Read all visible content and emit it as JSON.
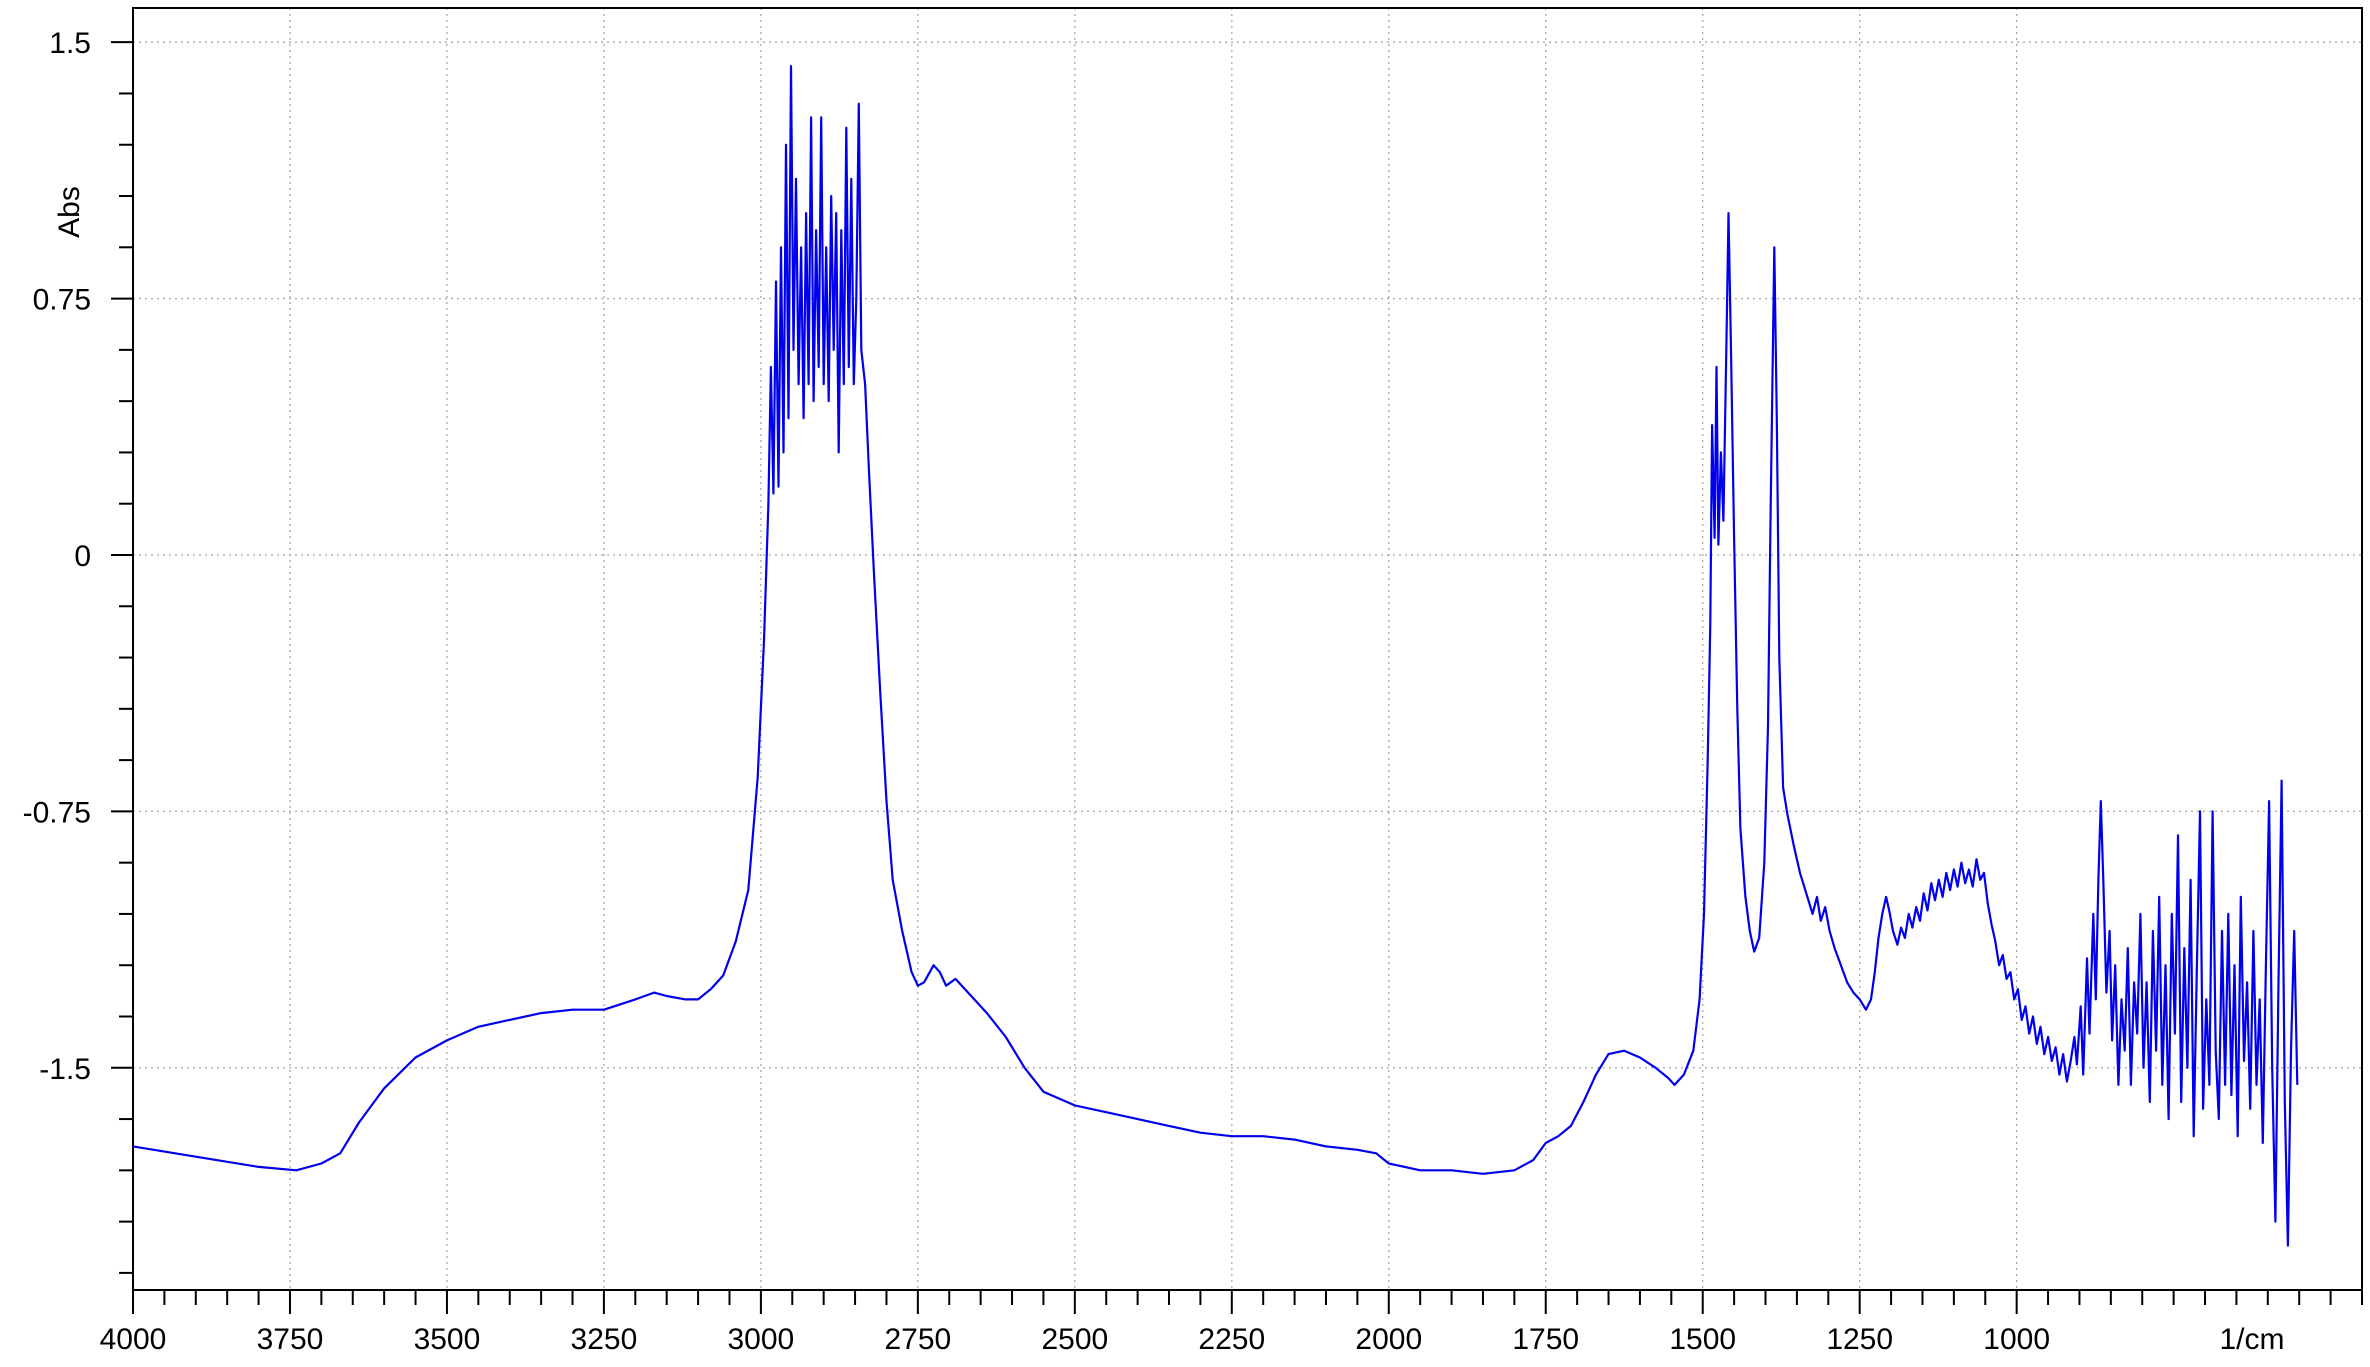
{
  "chart_data": {
    "type": "line",
    "ylabel": "Abs",
    "xlabel": "1/cm",
    "x_reversed": true,
    "xlim": [
      4000,
      450
    ],
    "ylim": [
      -2.15,
      1.6
    ],
    "x_ticks": [
      4000,
      3750,
      3500,
      3250,
      3000,
      2750,
      2500,
      2250,
      2000,
      1750,
      1500,
      1250,
      1000
    ],
    "x_tick_labels": [
      "4000",
      "3750",
      "3500",
      "3250",
      "3000",
      "2750",
      "2500",
      "2250",
      "2000",
      "1750",
      "1500",
      "1250",
      "1000"
    ],
    "x_minor_step": 50,
    "y_ticks": [
      1.5,
      0.75,
      0,
      -0.75,
      -1.5
    ],
    "y_tick_labels": [
      "1.5",
      "0.75",
      "0",
      "-0.75",
      "-1.5"
    ],
    "y_minor_step": 0.15,
    "grid": true,
    "colors": {
      "line": "#0000ee",
      "grid": "#a8a8a8",
      "frame": "#000000"
    },
    "series": [
      {
        "points": [
          [
            4000,
            -1.73
          ],
          [
            3900,
            -1.76
          ],
          [
            3800,
            -1.79
          ],
          [
            3740,
            -1.8
          ],
          [
            3700,
            -1.78
          ],
          [
            3670,
            -1.75
          ],
          [
            3640,
            -1.66
          ],
          [
            3600,
            -1.56
          ],
          [
            3550,
            -1.47
          ],
          [
            3500,
            -1.42
          ],
          [
            3450,
            -1.38
          ],
          [
            3400,
            -1.36
          ],
          [
            3350,
            -1.34
          ],
          [
            3300,
            -1.33
          ],
          [
            3250,
            -1.33
          ],
          [
            3200,
            -1.3
          ],
          [
            3170,
            -1.28
          ],
          [
            3150,
            -1.29
          ],
          [
            3120,
            -1.3
          ],
          [
            3100,
            -1.3
          ],
          [
            3080,
            -1.27
          ],
          [
            3060,
            -1.23
          ],
          [
            3040,
            -1.13
          ],
          [
            3020,
            -0.98
          ],
          [
            3005,
            -0.65
          ],
          [
            2995,
            -0.25
          ],
          [
            2988,
            0.15
          ],
          [
            2984,
            0.55
          ],
          [
            2980,
            0.18
          ],
          [
            2976,
            0.8
          ],
          [
            2972,
            0.2
          ],
          [
            2968,
            0.9
          ],
          [
            2964,
            0.3
          ],
          [
            2960,
            1.2
          ],
          [
            2956,
            0.4
          ],
          [
            2952,
            1.43
          ],
          [
            2948,
            0.6
          ],
          [
            2944,
            1.1
          ],
          [
            2940,
            0.5
          ],
          [
            2936,
            0.9
          ],
          [
            2932,
            0.4
          ],
          [
            2928,
            1.0
          ],
          [
            2924,
            0.5
          ],
          [
            2920,
            1.28
          ],
          [
            2916,
            0.45
          ],
          [
            2912,
            0.95
          ],
          [
            2908,
            0.55
          ],
          [
            2904,
            1.28
          ],
          [
            2900,
            0.5
          ],
          [
            2896,
            0.9
          ],
          [
            2892,
            0.45
          ],
          [
            2888,
            1.05
          ],
          [
            2884,
            0.6
          ],
          [
            2880,
            1.0
          ],
          [
            2876,
            0.3
          ],
          [
            2872,
            0.95
          ],
          [
            2868,
            0.5
          ],
          [
            2864,
            1.25
          ],
          [
            2860,
            0.55
          ],
          [
            2856,
            1.1
          ],
          [
            2852,
            0.5
          ],
          [
            2848,
            0.75
          ],
          [
            2844,
            1.32
          ],
          [
            2840,
            0.6
          ],
          [
            2834,
            0.5
          ],
          [
            2828,
            0.25
          ],
          [
            2820,
            -0.05
          ],
          [
            2810,
            -0.4
          ],
          [
            2800,
            -0.72
          ],
          [
            2790,
            -0.95
          ],
          [
            2775,
            -1.1
          ],
          [
            2760,
            -1.22
          ],
          [
            2750,
            -1.26
          ],
          [
            2740,
            -1.25
          ],
          [
            2725,
            -1.2
          ],
          [
            2715,
            -1.22
          ],
          [
            2705,
            -1.26
          ],
          [
            2690,
            -1.24
          ],
          [
            2670,
            -1.28
          ],
          [
            2640,
            -1.34
          ],
          [
            2610,
            -1.41
          ],
          [
            2580,
            -1.5
          ],
          [
            2550,
            -1.57
          ],
          [
            2500,
            -1.61
          ],
          [
            2450,
            -1.63
          ],
          [
            2400,
            -1.65
          ],
          [
            2350,
            -1.67
          ],
          [
            2300,
            -1.69
          ],
          [
            2250,
            -1.7
          ],
          [
            2200,
            -1.7
          ],
          [
            2150,
            -1.71
          ],
          [
            2100,
            -1.73
          ],
          [
            2050,
            -1.74
          ],
          [
            2020,
            -1.75
          ],
          [
            2000,
            -1.78
          ],
          [
            1950,
            -1.8
          ],
          [
            1900,
            -1.8
          ],
          [
            1850,
            -1.81
          ],
          [
            1800,
            -1.8
          ],
          [
            1770,
            -1.77
          ],
          [
            1750,
            -1.72
          ],
          [
            1730,
            -1.7
          ],
          [
            1710,
            -1.67
          ],
          [
            1690,
            -1.6
          ],
          [
            1670,
            -1.52
          ],
          [
            1650,
            -1.46
          ],
          [
            1625,
            -1.45
          ],
          [
            1600,
            -1.47
          ],
          [
            1575,
            -1.5
          ],
          [
            1555,
            -1.53
          ],
          [
            1545,
            -1.55
          ],
          [
            1530,
            -1.52
          ],
          [
            1515,
            -1.45
          ],
          [
            1505,
            -1.3
          ],
          [
            1498,
            -1.05
          ],
          [
            1492,
            -0.6
          ],
          [
            1488,
            -0.2
          ],
          [
            1485,
            0.38
          ],
          [
            1481,
            0.05
          ],
          [
            1478,
            0.55
          ],
          [
            1475,
            0.03
          ],
          [
            1471,
            0.3
          ],
          [
            1467,
            0.1
          ],
          [
            1462,
            0.65
          ],
          [
            1459,
            1.0
          ],
          [
            1455,
            0.6
          ],
          [
            1450,
            0.05
          ],
          [
            1445,
            -0.45
          ],
          [
            1440,
            -0.8
          ],
          [
            1432,
            -1.0
          ],
          [
            1425,
            -1.1
          ],
          [
            1418,
            -1.16
          ],
          [
            1410,
            -1.12
          ],
          [
            1402,
            -0.9
          ],
          [
            1396,
            -0.5
          ],
          [
            1392,
            0.1
          ],
          [
            1389,
            0.5
          ],
          [
            1386,
            0.9
          ],
          [
            1382,
            0.4
          ],
          [
            1378,
            -0.3
          ],
          [
            1372,
            -0.68
          ],
          [
            1365,
            -0.76
          ],
          [
            1355,
            -0.85
          ],
          [
            1345,
            -0.93
          ],
          [
            1335,
            -0.99
          ],
          [
            1325,
            -1.05
          ],
          [
            1318,
            -1.0
          ],
          [
            1312,
            -1.07
          ],
          [
            1305,
            -1.03
          ],
          [
            1298,
            -1.1
          ],
          [
            1290,
            -1.15
          ],
          [
            1280,
            -1.2
          ],
          [
            1270,
            -1.25
          ],
          [
            1260,
            -1.28
          ],
          [
            1250,
            -1.3
          ],
          [
            1240,
            -1.33
          ],
          [
            1232,
            -1.3
          ],
          [
            1226,
            -1.22
          ],
          [
            1220,
            -1.12
          ],
          [
            1214,
            -1.05
          ],
          [
            1208,
            -1.0
          ],
          [
            1203,
            -1.04
          ],
          [
            1197,
            -1.1
          ],
          [
            1190,
            -1.14
          ],
          [
            1184,
            -1.09
          ],
          [
            1178,
            -1.12
          ],
          [
            1172,
            -1.05
          ],
          [
            1166,
            -1.09
          ],
          [
            1160,
            -1.03
          ],
          [
            1154,
            -1.07
          ],
          [
            1148,
            -0.99
          ],
          [
            1142,
            -1.04
          ],
          [
            1136,
            -0.96
          ],
          [
            1130,
            -1.01
          ],
          [
            1124,
            -0.95
          ],
          [
            1118,
            -1.0
          ],
          [
            1112,
            -0.93
          ],
          [
            1106,
            -0.98
          ],
          [
            1100,
            -0.92
          ],
          [
            1094,
            -0.97
          ],
          [
            1088,
            -0.9
          ],
          [
            1082,
            -0.96
          ],
          [
            1076,
            -0.92
          ],
          [
            1070,
            -0.97
          ],
          [
            1064,
            -0.89
          ],
          [
            1058,
            -0.95
          ],
          [
            1052,
            -0.93
          ],
          [
            1046,
            -1.02
          ],
          [
            1040,
            -1.08
          ],
          [
            1034,
            -1.13
          ],
          [
            1028,
            -1.2
          ],
          [
            1022,
            -1.17
          ],
          [
            1016,
            -1.24
          ],
          [
            1010,
            -1.22
          ],
          [
            1004,
            -1.3
          ],
          [
            998,
            -1.27
          ],
          [
            992,
            -1.36
          ],
          [
            986,
            -1.32
          ],
          [
            980,
            -1.4
          ],
          [
            974,
            -1.35
          ],
          [
            968,
            -1.43
          ],
          [
            962,
            -1.38
          ],
          [
            956,
            -1.46
          ],
          [
            950,
            -1.41
          ],
          [
            944,
            -1.48
          ],
          [
            938,
            -1.44
          ],
          [
            932,
            -1.52
          ],
          [
            926,
            -1.46
          ],
          [
            920,
            -1.54
          ],
          [
            914,
            -1.48
          ],
          [
            908,
            -1.41
          ],
          [
            904,
            -1.49
          ],
          [
            898,
            -1.32
          ],
          [
            894,
            -1.52
          ],
          [
            888,
            -1.18
          ],
          [
            884,
            -1.4
          ],
          [
            878,
            -1.05
          ],
          [
            874,
            -1.3
          ],
          [
            870,
            -0.96
          ],
          [
            866,
            -0.72
          ],
          [
            862,
            -0.95
          ],
          [
            857,
            -1.28
          ],
          [
            852,
            -1.1
          ],
          [
            848,
            -1.42
          ],
          [
            843,
            -1.2
          ],
          [
            838,
            -1.55
          ],
          [
            833,
            -1.3
          ],
          [
            828,
            -1.45
          ],
          [
            823,
            -1.15
          ],
          [
            818,
            -1.55
          ],
          [
            813,
            -1.25
          ],
          [
            808,
            -1.4
          ],
          [
            803,
            -1.05
          ],
          [
            798,
            -1.5
          ],
          [
            793,
            -1.25
          ],
          [
            788,
            -1.6
          ],
          [
            783,
            -1.1
          ],
          [
            778,
            -1.45
          ],
          [
            773,
            -1.0
          ],
          [
            768,
            -1.55
          ],
          [
            763,
            -1.2
          ],
          [
            758,
            -1.65
          ],
          [
            753,
            -1.05
          ],
          [
            748,
            -1.4
          ],
          [
            743,
            -0.82
          ],
          [
            738,
            -1.6
          ],
          [
            733,
            -1.15
          ],
          [
            728,
            -1.5
          ],
          [
            723,
            -0.95
          ],
          [
            718,
            -1.7
          ],
          [
            713,
            -1.2
          ],
          [
            708,
            -0.75
          ],
          [
            703,
            -1.62
          ],
          [
            698,
            -1.3
          ],
          [
            693,
            -1.55
          ],
          [
            688,
            -0.75
          ],
          [
            683,
            -1.45
          ],
          [
            678,
            -1.65
          ],
          [
            673,
            -1.1
          ],
          [
            668,
            -1.55
          ],
          [
            663,
            -1.05
          ],
          [
            658,
            -1.58
          ],
          [
            653,
            -1.2
          ],
          [
            648,
            -1.7
          ],
          [
            643,
            -1.0
          ],
          [
            638,
            -1.48
          ],
          [
            633,
            -1.25
          ],
          [
            628,
            -1.62
          ],
          [
            623,
            -1.1
          ],
          [
            618,
            -1.55
          ],
          [
            613,
            -1.3
          ],
          [
            608,
            -1.72
          ],
          [
            603,
            -1.2
          ],
          [
            598,
            -0.72
          ],
          [
            593,
            -1.5
          ],
          [
            588,
            -1.95
          ],
          [
            583,
            -1.25
          ],
          [
            578,
            -0.66
          ],
          [
            573,
            -1.6
          ],
          [
            568,
            -2.02
          ],
          [
            563,
            -1.45
          ],
          [
            558,
            -1.1
          ],
          [
            553,
            -1.55
          ]
        ]
      }
    ]
  }
}
